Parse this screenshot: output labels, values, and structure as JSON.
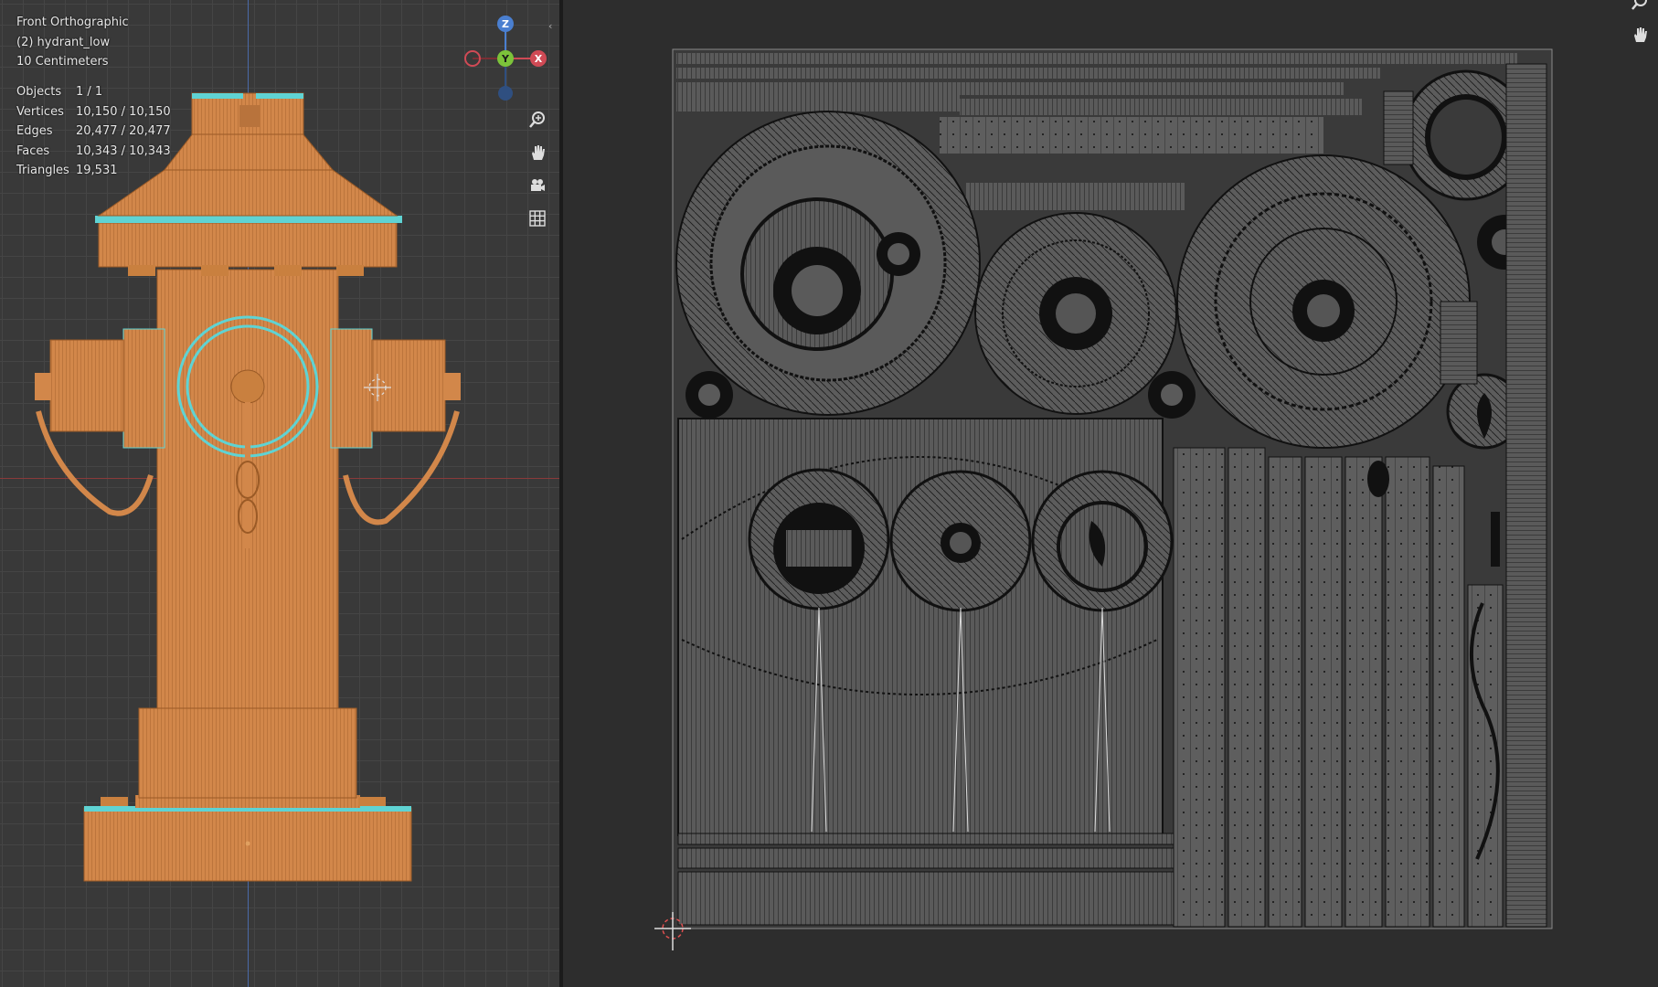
{
  "viewport": {
    "view_name": "Front Orthographic",
    "object_name": "(2) hydrant_low",
    "grid_scale": "10 Centimeters",
    "stats": [
      {
        "label": "Objects",
        "value": "1 / 1"
      },
      {
        "label": "Vertices",
        "value": "10,150 / 10,150"
      },
      {
        "label": "Edges",
        "value": "20,477 / 20,477"
      },
      {
        "label": "Faces",
        "value": "10,343 / 10,343"
      },
      {
        "label": "Triangles",
        "value": "19,531"
      }
    ],
    "gizmo": {
      "z": "Z",
      "y": "Y",
      "x": "X"
    },
    "tools": [
      "zoom-icon",
      "pan-hand-icon",
      "camera-icon",
      "grid-icon"
    ]
  },
  "uv_editor": {
    "tools": [
      "zoom-icon",
      "pan-hand-icon"
    ]
  },
  "colors": {
    "mesh_orange": "#d2874a",
    "mesh_wire": "#9a5a26",
    "selected_edge": "#5fd3d3",
    "uv_fill": "#595959",
    "uv_line": "#111111",
    "background": "#393939"
  }
}
